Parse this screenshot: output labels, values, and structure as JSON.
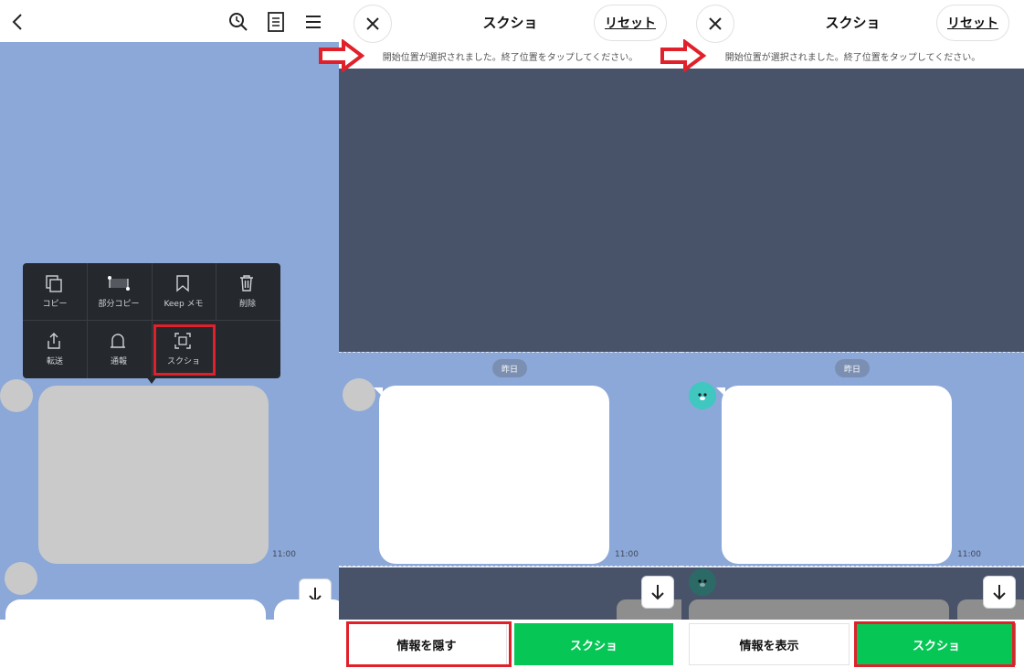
{
  "panel1": {
    "menu_items": [
      {
        "label": "コピー",
        "icon": "copy-icon"
      },
      {
        "label": "部分コピー",
        "icon": "partial-copy-icon"
      },
      {
        "label": "Keep メモ",
        "icon": "bookmark-icon"
      },
      {
        "label": "削除",
        "icon": "trash-icon"
      },
      {
        "label": "転送",
        "icon": "share-icon"
      },
      {
        "label": "通報",
        "icon": "bell-icon"
      },
      {
        "label": "スクショ",
        "icon": "screenshot-icon"
      }
    ],
    "time": "11:00"
  },
  "panel2": {
    "title": "スクショ",
    "reset_label": "リセット",
    "notice": "開始位置が選択されました。終了位置をタップしてください。",
    "date_chip": "昨日",
    "time": "11:00",
    "left_button": "情報を隠す",
    "right_button": "スクショ"
  },
  "panel3": {
    "title": "スクショ",
    "reset_label": "リセット",
    "notice": "開始位置が選択されました。終了位置をタップしてください。",
    "date_chip": "昨日",
    "time": "11:00",
    "left_button": "情報を表示",
    "right_button": "スクショ"
  },
  "colors": {
    "chat_bg": "#8ca8d8",
    "dim_bg": "#485369",
    "green": "#06c755",
    "highlight_red": "#e0202a"
  }
}
